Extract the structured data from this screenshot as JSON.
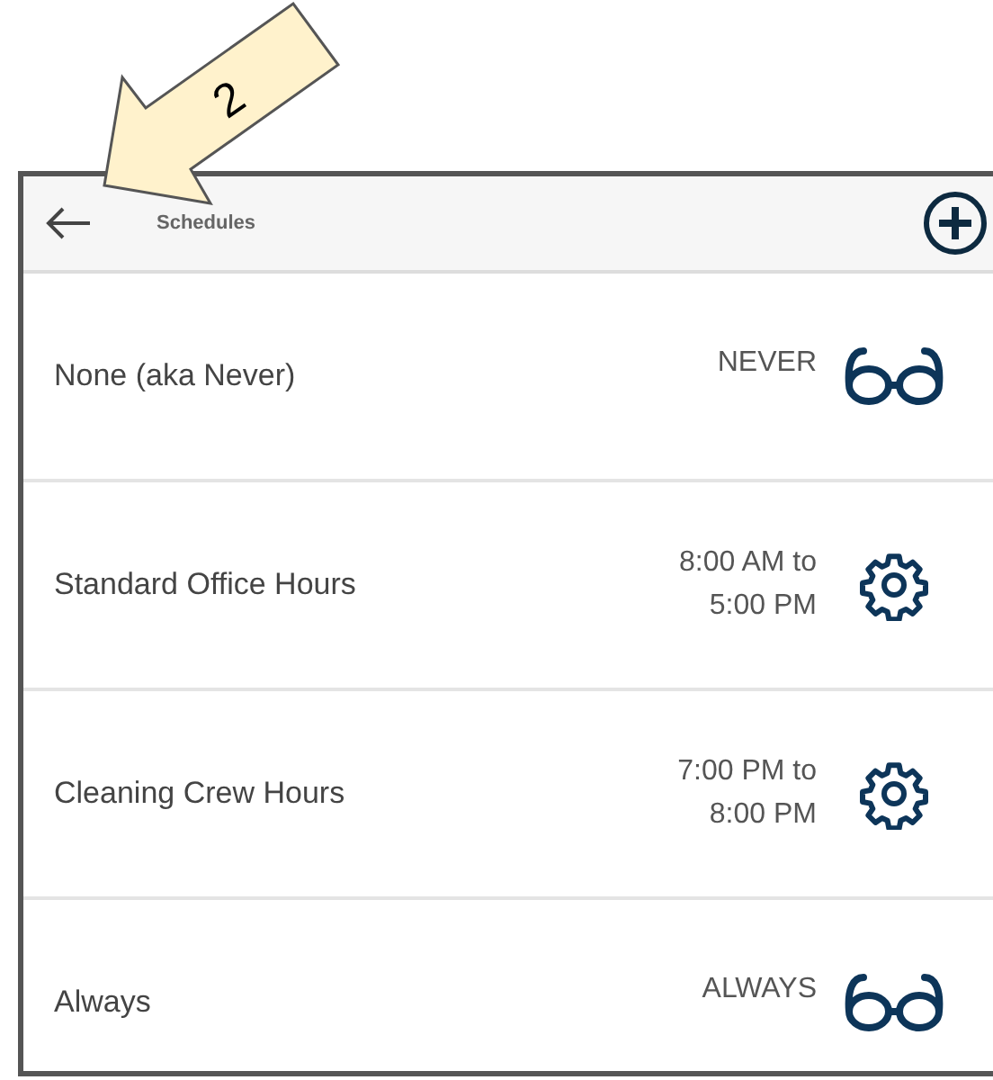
{
  "callout": {
    "label": "2"
  },
  "header": {
    "title": "Schedules"
  },
  "schedules": [
    {
      "name": "None (aka Never)",
      "times": [
        "NEVER"
      ],
      "kind": "view"
    },
    {
      "name": "Standard Office Hours",
      "times": [
        "8:00 AM to",
        "5:00 PM"
      ],
      "kind": "edit"
    },
    {
      "name": "Cleaning Crew Hours",
      "times": [
        "7:00 PM to",
        "8:00 PM"
      ],
      "kind": "edit"
    },
    {
      "name": "Always",
      "times": [
        "ALWAYS"
      ],
      "kind": "view"
    }
  ]
}
